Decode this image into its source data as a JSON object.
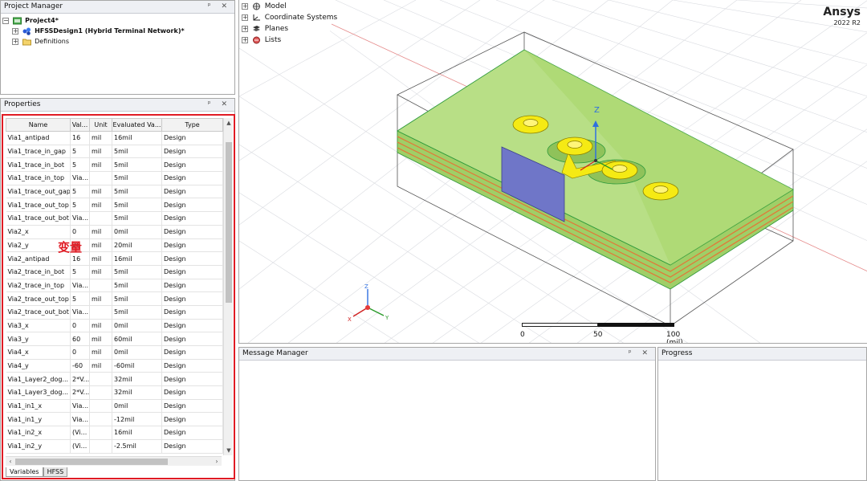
{
  "project_manager": {
    "title": "Project Manager",
    "tree": [
      {
        "label": "Project4*",
        "level": 0,
        "expander": "−"
      },
      {
        "label": "HFSSDesign1 (Hybrid Terminal Network)*",
        "level": 1,
        "expander": "+"
      },
      {
        "label": "Definitions",
        "level": 1,
        "expander": "+"
      }
    ]
  },
  "window_buttons": "ᵖ ✕",
  "properties": {
    "title": "Properties",
    "columns": [
      "Name",
      "Val...",
      "Unit",
      "Evaluated Va...",
      "Type"
    ],
    "rows": [
      [
        "Via1_antipad",
        "16",
        "mil",
        "16mil",
        "Design"
      ],
      [
        "Via1_trace_in_gap",
        "5",
        "mil",
        "5mil",
        "Design"
      ],
      [
        "Via1_trace_in_bot",
        "5",
        "mil",
        "5mil",
        "Design"
      ],
      [
        "Via1_trace_in_top",
        "Via...",
        "",
        "5mil",
        "Design"
      ],
      [
        "Via1_trace_out_gap",
        "5",
        "mil",
        "5mil",
        "Design"
      ],
      [
        "Via1_trace_out_top",
        "5",
        "mil",
        "5mil",
        "Design"
      ],
      [
        "Via1_trace_out_bot",
        "Via...",
        "",
        "5mil",
        "Design"
      ],
      [
        "Via2_x",
        "0",
        "mil",
        "0mil",
        "Design"
      ],
      [
        "Via2_y",
        "20",
        "mil",
        "20mil",
        "Design"
      ],
      [
        "Via2_antipad",
        "16",
        "mil",
        "16mil",
        "Design"
      ],
      [
        "Via2_trace_in_bot",
        "5",
        "mil",
        "5mil",
        "Design"
      ],
      [
        "Via2_trace_in_top",
        "Via...",
        "",
        "5mil",
        "Design"
      ],
      [
        "Via2_trace_out_top",
        "5",
        "mil",
        "5mil",
        "Design"
      ],
      [
        "Via2_trace_out_bot",
        "Via...",
        "",
        "5mil",
        "Design"
      ],
      [
        "Via3_x",
        "0",
        "mil",
        "0mil",
        "Design"
      ],
      [
        "Via3_y",
        "60",
        "mil",
        "60mil",
        "Design"
      ],
      [
        "Via4_x",
        "0",
        "mil",
        "0mil",
        "Design"
      ],
      [
        "Via4_y",
        "-60",
        "mil",
        "-60mil",
        "Design"
      ],
      [
        "Via1_Layer2_dog...",
        "2*V...",
        "",
        "32mil",
        "Design"
      ],
      [
        "Via1_Layer3_dog...",
        "2*V...",
        "",
        "32mil",
        "Design"
      ],
      [
        "Via1_in1_x",
        "Via...",
        "",
        "0mil",
        "Design"
      ],
      [
        "Via1_in1_y",
        "Via...",
        "",
        "-12mil",
        "Design"
      ],
      [
        "Via1_in2_x",
        "(Vi...",
        "",
        "16mil",
        "Design"
      ],
      [
        "Via1_in2_y",
        "(Vi...",
        "",
        "-2.5mil",
        "Design"
      ]
    ],
    "tabs": [
      "Variables",
      "HFSS"
    ],
    "annotation": "变量"
  },
  "model_tree": [
    {
      "label": "Model",
      "icon": "model-icon"
    },
    {
      "label": "Coordinate Systems",
      "icon": "coordinate-systems-icon"
    },
    {
      "label": "Planes",
      "icon": "planes-icon"
    },
    {
      "label": "Lists",
      "icon": "lists-icon"
    }
  ],
  "viewport": {
    "brand": "Ansys",
    "version": "2022 R2",
    "axis_z": "Z",
    "scale_labels": [
      "0",
      "50",
      "100 (mil)"
    ]
  },
  "message_manager": {
    "title": "Message Manager"
  },
  "progress": {
    "title": "Progress"
  },
  "colors": {
    "substrate": "#a8d66a",
    "substrate_edge": "#2e9a3c",
    "via_pad": "#f5ea14",
    "port": "#6f76c8",
    "copper_stripe": "#e07a3a",
    "annotation": "#e01b24"
  }
}
